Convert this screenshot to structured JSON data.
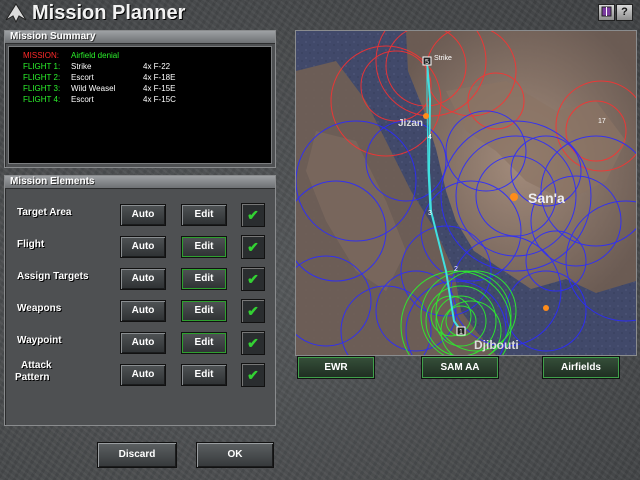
{
  "app": {
    "title": "Mission Planner"
  },
  "top_buttons": {
    "help_label": "?"
  },
  "colors": {
    "mission_label": "#ff2a2a",
    "flight_label": "#2cf22c",
    "check": "#33d133"
  },
  "summary": {
    "header": "Mission Summary",
    "rows": [
      {
        "label": "MISSION:",
        "role": "Airfield denial",
        "craft": "",
        "color": "red"
      },
      {
        "label": "FLIGHT 1:",
        "role": "Strike",
        "craft": "4x F-22",
        "color": "green"
      },
      {
        "label": "FLIGHT 2:",
        "role": "Escort",
        "craft": "4x F-18E",
        "color": "green"
      },
      {
        "label": "FLIGHT 3:",
        "role": "Wild Weasel",
        "craft": "4x F-15E",
        "color": "green"
      },
      {
        "label": "FLIGHT 4:",
        "role": "Escort",
        "craft": "4x F-15C",
        "color": "green"
      }
    ]
  },
  "elements": {
    "header": "Mission Elements",
    "rows": [
      {
        "label": "Target Area",
        "auto": "Auto",
        "edit": "Edit",
        "check": "✔"
      },
      {
        "label": "Flight",
        "auto": "Auto",
        "edit": "Edit",
        "check": "✔"
      },
      {
        "label": "Assign Targets",
        "auto": "Auto",
        "edit": "Edit",
        "check": "✔"
      },
      {
        "label": "Weapons",
        "auto": "Auto",
        "edit": "Edit",
        "check": "✔"
      },
      {
        "label": "Waypoint",
        "auto": "Auto",
        "edit": "Edit",
        "check": "✔"
      },
      {
        "label": "Attack Pattern",
        "label_line1": "Attack",
        "label_line2": "Pattern",
        "auto": "Auto",
        "edit": "Edit",
        "check": "✔"
      }
    ]
  },
  "map": {
    "labels": {
      "strike": "Strike",
      "city1": "Jizan",
      "city2": "San'a",
      "city3": "Djibouti",
      "waypoints": [
        "5",
        "4",
        "3",
        "2",
        "1"
      ],
      "marker17": "17"
    },
    "buttons": {
      "ewr": "EWR",
      "sam": "SAM AA",
      "airfields": "Airfields"
    }
  },
  "footer": {
    "discard": "Discard",
    "ok": "OK"
  }
}
